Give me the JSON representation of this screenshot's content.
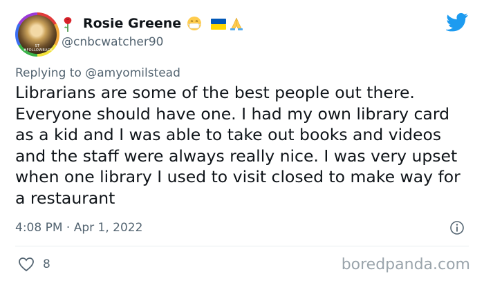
{
  "tweet": {
    "display_name": "Rosie Greene",
    "handle": "@cnbcwatcher90",
    "reply_prefix": "Replying to ",
    "reply_to": "@amyomilstead",
    "text": "Librarians are some of the best people out there. Everyone should have one. I had my own library card as a kid and I was able to take out books and videos and the staff were always really nice. I was very upset when one library I used to visit closed to make way for a restaurant",
    "timestamp": "4:08 PM · Apr 1, 2022",
    "likes": "8"
  },
  "avatar": {
    "label": "ST #FOLLOWBACK"
  },
  "icons": {
    "name_prefix": "rose-icon",
    "name_suffix": [
      "mask-face-icon",
      "ukraine-flag-icon",
      "praying-hands-icon"
    ],
    "brand": "twitter-bird-icon",
    "info": "info-icon",
    "like": "heart-icon"
  },
  "watermark": "boredpanda.com",
  "colors": {
    "text": "#0f1419",
    "secondary": "#536471",
    "twitter_blue": "#1d9bf0",
    "divider": "#e6ecf0",
    "watermark": "#9aa4ab"
  }
}
